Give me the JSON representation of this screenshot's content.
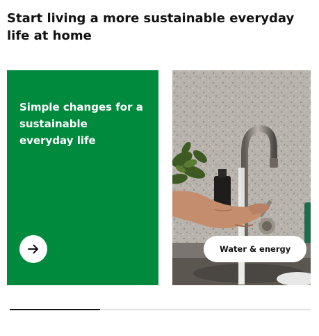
{
  "section": {
    "title": "Start living a more sustainable everyday life at home"
  },
  "cards": [
    {
      "title": "Simple changes for a sustainable everyday life",
      "background": "#008a3e",
      "button_icon": "arrow-right-icon"
    },
    {
      "image": "kitchen-faucet-photo",
      "tag_label": "Water & energy"
    }
  ],
  "scrollbar": {
    "position": 0.0,
    "visible_fraction": 0.3
  },
  "colors": {
    "accent_green": "#008a3e",
    "text": "#111111",
    "track": "#dfdfdf"
  }
}
